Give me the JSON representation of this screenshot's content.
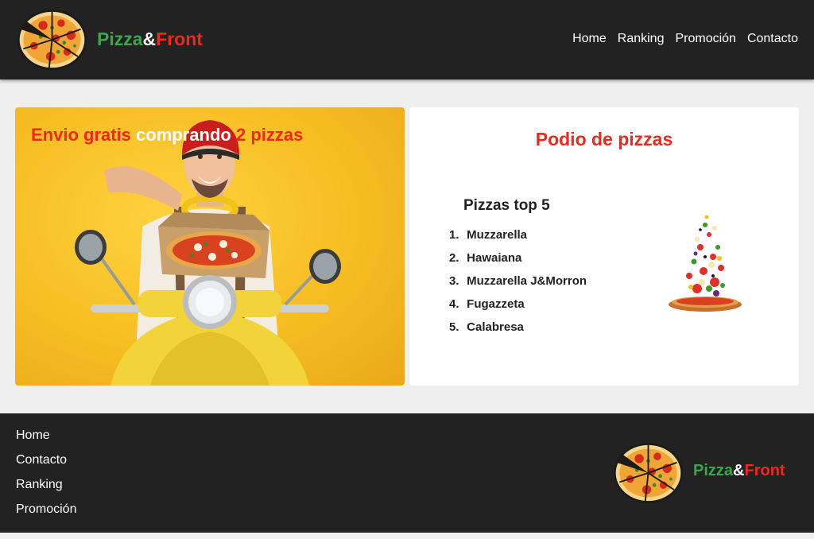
{
  "header": {
    "brand": {
      "part1": "Pizza",
      "part2": "&",
      "part3": "Front"
    },
    "logo_icon": "pizza-logo-icon",
    "nav": [
      "Home",
      "Ranking",
      "Promoción",
      "Contacto"
    ]
  },
  "promo": {
    "title_part1": "Envio gratis",
    "title_part2": "comprando",
    "title_part3": "2 pizzas",
    "image": "delivery-man-on-scooter-with-pizza"
  },
  "podium": {
    "title": "Podio de pizzas",
    "list_title": "Pizzas top 5",
    "items": [
      {
        "num": "1.",
        "name": "Muzzarella"
      },
      {
        "num": "2.",
        "name": "Hawaiana"
      },
      {
        "num": "3.",
        "name": "Muzzarella J&Morron"
      },
      {
        "num": "4.",
        "name": "Fugazzeta"
      },
      {
        "num": "5.",
        "name": "Calabresa"
      }
    ],
    "image": "flying-pizza-ingredients"
  },
  "footer": {
    "links": [
      "Home",
      "Contacto",
      "Ranking",
      "Promoción"
    ],
    "brand": {
      "part1": "Pizza",
      "part2": "&",
      "part3": "Front"
    }
  },
  "colors": {
    "dark": "#222222",
    "red": "#f0271c",
    "green": "#3aa84a",
    "yellow": "#f6be22"
  }
}
